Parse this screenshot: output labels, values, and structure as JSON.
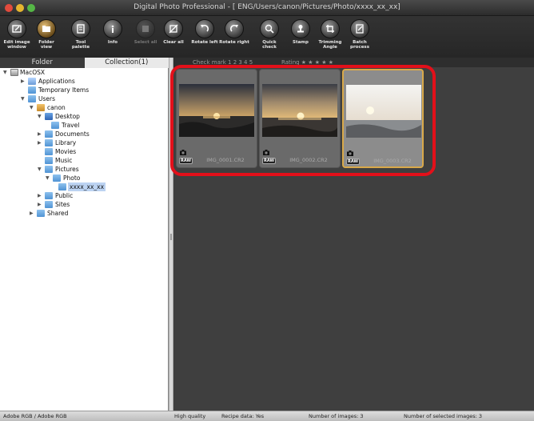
{
  "window": {
    "title": "Digital Photo Professional - [ ENG/Users/canon/Pictures/Photo/xxxx_xx_xx]"
  },
  "toolbar": {
    "buttons": [
      {
        "label": "Edit image\nwindow",
        "icon": "edit-image-icon"
      },
      {
        "label": "Folder\nview",
        "icon": "folder-view-icon"
      },
      {
        "label": "Tool\npalette",
        "icon": "tool-palette-icon"
      },
      {
        "label": "Info",
        "icon": "info-icon"
      },
      {
        "label": "Select all",
        "icon": "select-all-icon"
      },
      {
        "label": "Clear all",
        "icon": "clear-all-icon"
      },
      {
        "label": "Rotate left",
        "icon": "rotate-left-icon"
      },
      {
        "label": "Rotate right",
        "icon": "rotate-right-icon"
      },
      {
        "label": "Quick\ncheck",
        "icon": "quick-check-icon"
      },
      {
        "label": "Stamp",
        "icon": "stamp-icon"
      },
      {
        "label": "Trimming\nAngle",
        "icon": "trimming-icon"
      },
      {
        "label": "Batch\nprocess",
        "icon": "batch-process-icon"
      }
    ]
  },
  "tabs": {
    "folder": "Folder",
    "collection": "Collection(1)"
  },
  "tree": {
    "macosx": "MacOSX",
    "applications": "Applications",
    "temporary_items": "Temporary Items",
    "users": "Users",
    "canon": "canon",
    "desktop": "Desktop",
    "travel": "Travel",
    "documents": "Documents",
    "library": "Library",
    "movies": "Movies",
    "music": "Music",
    "pictures": "Pictures",
    "photo": "Photo",
    "xxxx": "xxxx_xx_xx",
    "public": "Public",
    "sites": "Sites",
    "shared": "Shared"
  },
  "filterbar": {
    "check_mark": "Check mark   1  2  3  4  5",
    "rating": "Rating  ★ ★ ★ ★ ★"
  },
  "thumbnails": [
    {
      "filename": "IMG_0001.CR2",
      "badge": "RAW"
    },
    {
      "filename": "IMG_0002.CR2",
      "badge": "RAW"
    },
    {
      "filename": "IMG_0003.CR2",
      "badge": "RAW"
    }
  ],
  "status": {
    "color_space": "Adobe RGB / Adobe RGB",
    "quality": "High quality",
    "recipe": "Recipe data: Yes",
    "num_images": "Number of images: 3",
    "num_selected": "Number of selected images: 3"
  },
  "colors": {
    "highlight": "#e3101a",
    "selection_border": "#d9a94a",
    "tree_selection": "#bcd3f2"
  }
}
